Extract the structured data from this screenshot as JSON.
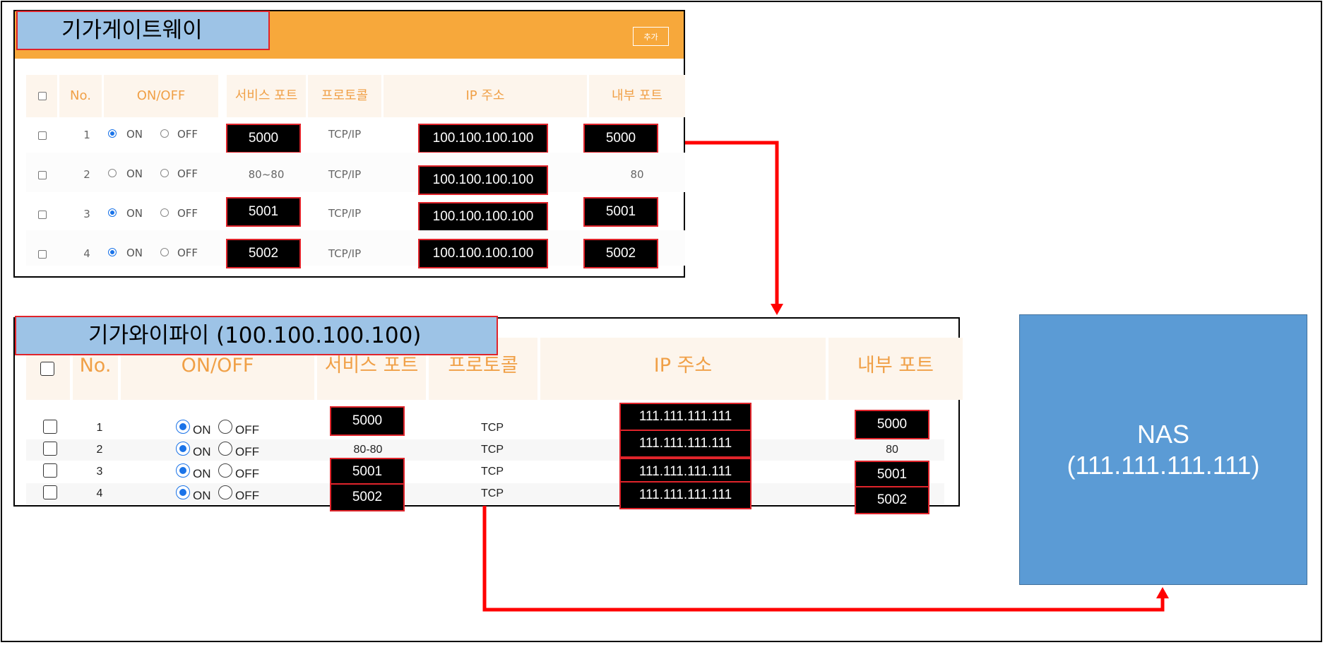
{
  "gateway": {
    "title": "기가게이트웨이",
    "add_button": "추가",
    "headers": {
      "no": "No.",
      "onoff": "ON/OFF",
      "service_port": "서비스 포트",
      "protocol": "프로토콜",
      "ip": "IP 주소",
      "internal_port": "내부 포트"
    },
    "on_label": "ON",
    "off_label": "OFF",
    "rows": [
      {
        "no": "1",
        "service_port": "5000",
        "protocol": "TCP/IP",
        "ip": "100.100.100.100",
        "internal_port": "5000"
      },
      {
        "no": "2",
        "service_port": "80~80",
        "protocol": "TCP/IP",
        "ip": "100.100.100.100",
        "internal_port": "80"
      },
      {
        "no": "3",
        "service_port": "5001",
        "protocol": "TCP/IP",
        "ip": "100.100.100.100",
        "internal_port": "5001"
      },
      {
        "no": "4",
        "service_port": "5002",
        "protocol": "TCP/IP",
        "ip": "100.100.100.100",
        "internal_port": "5002"
      }
    ]
  },
  "wifi": {
    "title": "기가와이파이 (100.100.100.100)",
    "headers": {
      "no": "No.",
      "onoff": "ON/OFF",
      "service_port": "서비스 포트",
      "protocol": "프로토콜",
      "ip": "IP 주소",
      "internal_port": "내부 포트"
    },
    "on_label": "ON",
    "off_label": "OFF",
    "rows": [
      {
        "no": "1",
        "service_port": "5000",
        "protocol": "TCP",
        "ip": "111.111.111.111",
        "internal_port": "5000"
      },
      {
        "no": "2",
        "service_port": "80-80",
        "protocol": "TCP",
        "ip": "111.111.111.111",
        "internal_port": "80"
      },
      {
        "no": "3",
        "service_port": "5001",
        "protocol": "TCP",
        "ip": "111.111.111.111",
        "internal_port": "5001"
      },
      {
        "no": "4",
        "service_port": "5002",
        "protocol": "TCP",
        "ip": "111.111.111.111",
        "internal_port": "5002"
      }
    ]
  },
  "nas": {
    "name": "NAS",
    "ip": "(111.111.111.111)"
  },
  "colors": {
    "arrow": "#ff0000",
    "gateway_bar": "#f7a83b",
    "title_fill": "#9dc3e6",
    "nas_fill": "#5b9bd5",
    "header_text": "#f0a047"
  }
}
